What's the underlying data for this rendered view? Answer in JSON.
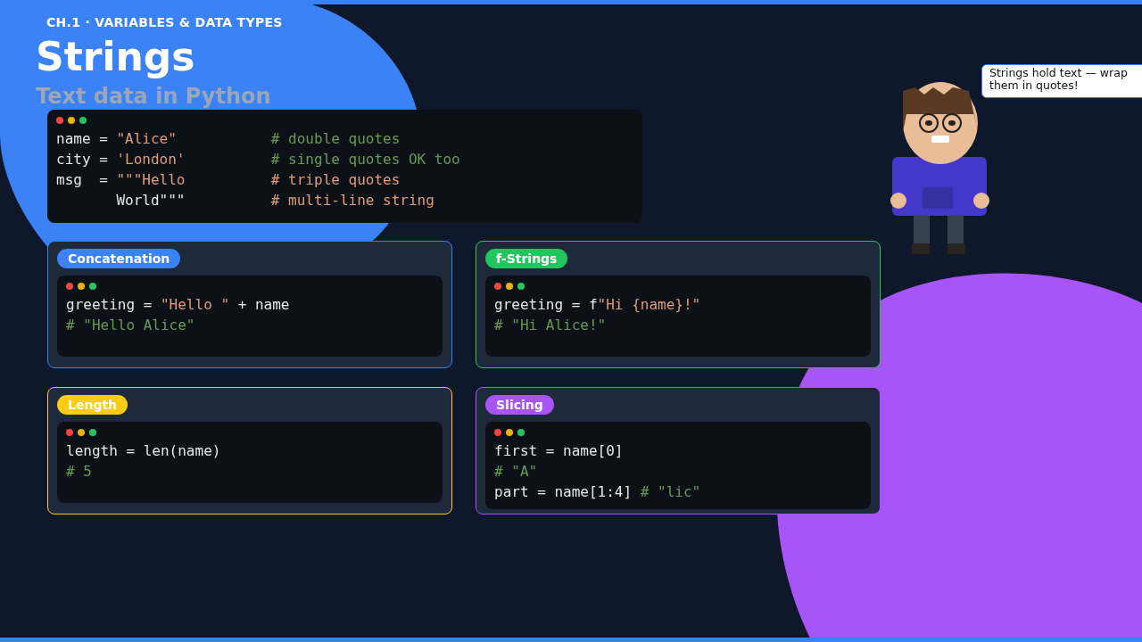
{
  "chapter": "CH.1 · VARIABLES & DATA TYPES",
  "title": "Strings",
  "subtitle": "Text data in Python",
  "main_code": [
    [
      {
        "kind": "plain",
        "text": "name = "
      },
      {
        "kind": "string",
        "text": "\"Alice\""
      },
      {
        "kind": "comment",
        "text": "           # double quotes"
      }
    ],
    [
      {
        "kind": "plain",
        "text": "city = "
      },
      {
        "kind": "string",
        "text": "'London'"
      },
      {
        "kind": "comment",
        "text": "          # single quotes OK too"
      }
    ],
    [
      {
        "kind": "plain",
        "text": "msg  = "
      },
      {
        "kind": "string",
        "text": "\"\"\"Hello          # triple quotes"
      }
    ],
    [
      {
        "kind": "plain",
        "text": "       World\"\"\"          "
      },
      {
        "kind": "string",
        "text": "# multi-line string"
      }
    ]
  ],
  "cards": [
    {
      "label": "Concatenation",
      "color": "#3b82f6",
      "code": [
        [
          {
            "kind": "plain",
            "text": "greeting = "
          },
          {
            "kind": "string",
            "text": "\"Hello \""
          },
          {
            "kind": "plain",
            "text": " + name"
          }
        ],
        [
          {
            "kind": "comment",
            "text": "# \"Hello Alice\""
          }
        ]
      ]
    },
    {
      "label": "f-Strings",
      "color": "#22c55e",
      "code": [
        [
          {
            "kind": "plain",
            "text": "greeting = f"
          },
          {
            "kind": "string",
            "text": "\"Hi {name}!\""
          }
        ],
        [
          {
            "kind": "comment",
            "text": "# \"Hi Alice!\""
          }
        ]
      ]
    },
    {
      "label": "Length",
      "color": "#facc15",
      "code": [
        [
          {
            "kind": "plain",
            "text": "length = len(name)"
          }
        ],
        [
          {
            "kind": "comment",
            "text": "# 5"
          }
        ]
      ]
    },
    {
      "label": "Slicing",
      "color": "#a855f7",
      "code": [
        [
          {
            "kind": "plain",
            "text": "first = name[0]"
          }
        ],
        [
          {
            "kind": "comment",
            "text": "# \"A\""
          }
        ],
        [
          {
            "kind": "plain",
            "text": "part = name[1:4] "
          },
          {
            "kind": "comment",
            "text": "# \"lic\""
          }
        ]
      ]
    }
  ],
  "speech": "Strings hold text — wrap them in quotes!"
}
